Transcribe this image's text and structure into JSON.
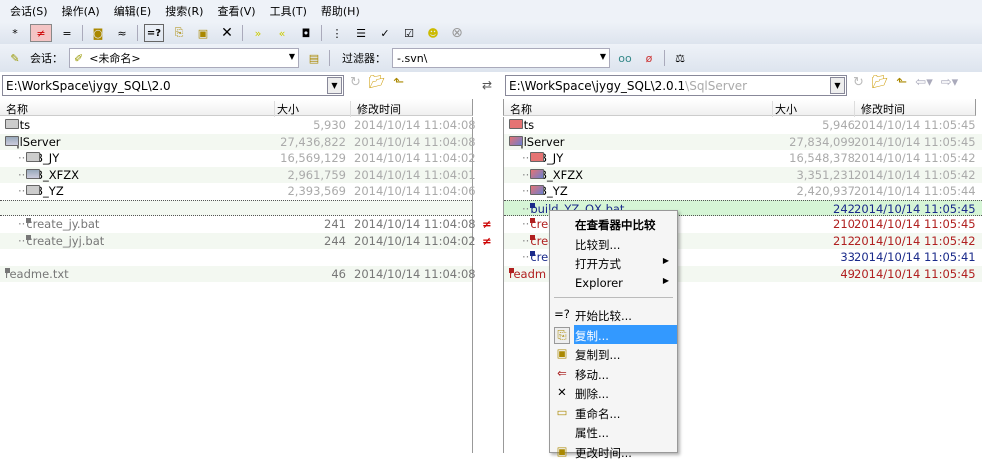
{
  "menu": [
    "会话(S)",
    "操作(A)",
    "编辑(E)",
    "搜索(R)",
    "查看(V)",
    "工具(T)",
    "帮助(H)"
  ],
  "session": {
    "label": "会话：",
    "value": "<未命名>",
    "filter_label": "过滤器：",
    "filter_value": "-.svn\\"
  },
  "left": {
    "path": "E:\\WorkSpace\\jygy_SQL\\2.0",
    "columns": [
      "名称",
      "大小",
      "修改时间"
    ],
    "rows": [
      {
        "name": "ddts",
        "size": "5,930",
        "time": "2014/10/14 11:04:08"
      },
      {
        "name": "SqlServer",
        "size": "27,436,822",
        "time": "2014/10/14 11:04:08"
      },
      {
        "name": "DB_JY",
        "size": "16,569,129",
        "time": "2014/10/14 11:04:02"
      },
      {
        "name": "DB_XFZX",
        "size": "2,961,759",
        "time": "2014/10/14 11:04:01"
      },
      {
        "name": "DB_YZ",
        "size": "2,393,569",
        "time": "2014/10/14 11:04:06"
      },
      {
        "name": "",
        "size": "",
        "time": ""
      },
      {
        "name": "create_jy.bat",
        "size": "241",
        "time": "2014/10/14 11:04:08"
      },
      {
        "name": "create_jyj.bat",
        "size": "244",
        "time": "2014/10/14 11:04:02"
      },
      {
        "name": "",
        "size": "",
        "time": ""
      },
      {
        "name": "readme.txt",
        "size": "46",
        "time": "2014/10/14 11:04:08"
      }
    ]
  },
  "right": {
    "path": "E:\\WorkSpace\\jygy_SQL\\2.0.1",
    "path_suffix": "\\SqlServer",
    "columns": [
      "名称",
      "大小",
      "修改时间"
    ],
    "rows": [
      {
        "name": "ddts",
        "size": "5,946",
        "time": "2014/10/14 11:05:45"
      },
      {
        "name": "SqlServer",
        "size": "27,834,099",
        "time": "2014/10/14 11:05:45"
      },
      {
        "name": "DB_JY",
        "size": "16,548,378",
        "time": "2014/10/14 11:05:42"
      },
      {
        "name": "DB_XFZX",
        "size": "3,351,231",
        "time": "2014/10/14 11:05:42"
      },
      {
        "name": "DB_YZ",
        "size": "2,420,937",
        "time": "2014/10/14 11:05:44"
      },
      {
        "name": "build_YZ_QX.bat",
        "size": "242",
        "time": "2014/10/14 11:05:45"
      },
      {
        "name": "crea",
        "size": "210",
        "time": "2014/10/14 11:05:45"
      },
      {
        "name": "crea",
        "size": "212",
        "time": "2014/10/14 11:05:42"
      },
      {
        "name": "crea",
        "size": "33",
        "time": "2014/10/14 11:05:41"
      },
      {
        "name": "readm",
        "size": "49",
        "time": "2014/10/14 11:05:45"
      }
    ]
  },
  "diff_marks": [
    "≠",
    "≠"
  ],
  "context_menu": [
    {
      "label": "在查看器中比较",
      "bold": true
    },
    {
      "label": "比较到..."
    },
    {
      "label": "打开方式",
      "submenu": true
    },
    {
      "label": "Explorer",
      "submenu": true
    },
    {
      "label": "开始比较..."
    },
    {
      "label": "复制...",
      "selected": true
    },
    {
      "label": "复制到..."
    },
    {
      "label": "移动..."
    },
    {
      "label": "删除..."
    },
    {
      "label": "重命名..."
    },
    {
      "label": "属性..."
    },
    {
      "label": "更改时间..."
    }
  ],
  "colors": {
    "selection": "#3399ff",
    "row_highlight": "#d6f5d6",
    "diff_red": "#b02020",
    "new_blue": "#1a2a8a"
  }
}
